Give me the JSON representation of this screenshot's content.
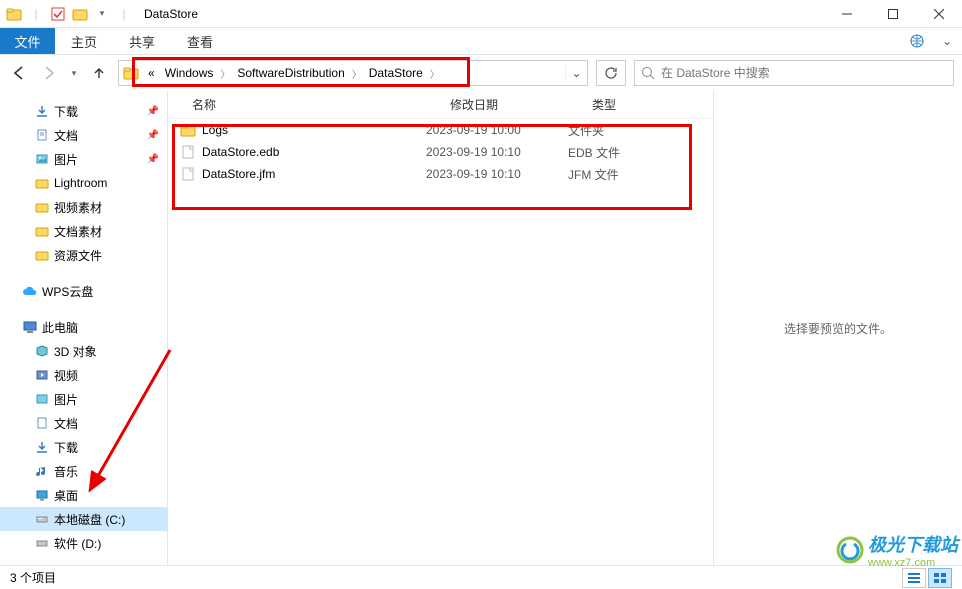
{
  "window": {
    "title": "DataStore"
  },
  "ribbon": {
    "file": "文件",
    "home": "主页",
    "share": "共享",
    "view": "查看"
  },
  "breadcrumb": {
    "overflow": "«",
    "items": [
      "Windows",
      "SoftwareDistribution",
      "DataStore"
    ]
  },
  "search": {
    "placeholder": "在 DataStore 中搜索"
  },
  "tree": {
    "downloads": "下载",
    "documents": "文档",
    "pictures": "图片",
    "lightroom": "Lightroom",
    "video_mat": "视频素材",
    "doc_mat": "文档素材",
    "res_files": "资源文件",
    "wps": "WPS云盘",
    "thispc": "此电脑",
    "obj3d": "3D 对象",
    "videos": "视频",
    "pictures2": "图片",
    "documents2": "文档",
    "downloads2": "下载",
    "music": "音乐",
    "desktop": "桌面",
    "drive_c": "本地磁盘 (C:)",
    "drive_d": "软件 (D:)"
  },
  "columns": {
    "name": "名称",
    "modified": "修改日期",
    "type": "类型"
  },
  "rows": [
    {
      "name": "Logs",
      "date": "2023-09-19 10:00",
      "type": "文件夹",
      "icon": "folder"
    },
    {
      "name": "DataStore.edb",
      "date": "2023-09-19 10:10",
      "type": "EDB 文件",
      "icon": "file"
    },
    {
      "name": "DataStore.jfm",
      "date": "2023-09-19 10:10",
      "type": "JFM 文件",
      "icon": "file"
    }
  ],
  "preview": {
    "empty": "选择要预览的文件。"
  },
  "status": {
    "count": "3 个项目"
  },
  "watermark": {
    "brand": "极光下载站",
    "url": "www.xz7.com"
  }
}
